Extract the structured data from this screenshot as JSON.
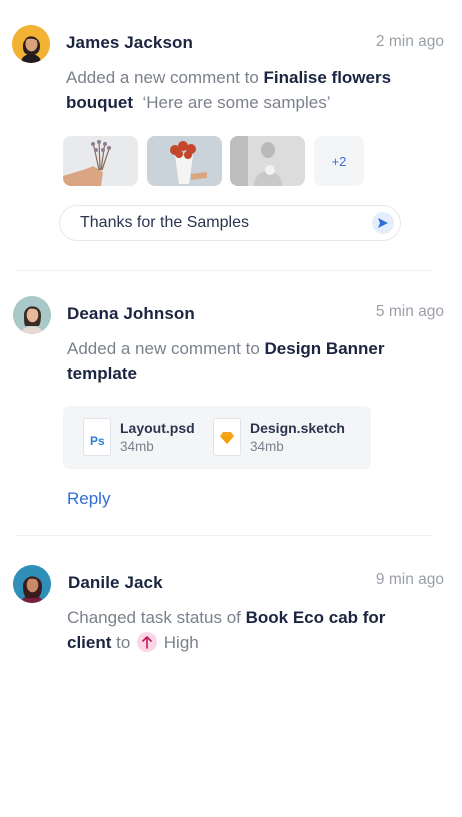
{
  "activities": [
    {
      "user": "James Jackson",
      "time": "2 min ago",
      "text_prefix": "Added a new comment to ",
      "target": "Finalise flowers bouquet",
      "quote": "‘Here are some samples’",
      "attachments_more": "+2",
      "reply_value": "Thanks for the Samples"
    },
    {
      "user": "Deana Johnson",
      "time": "5 min ago",
      "text_prefix": "Added a new comment to ",
      "target": "Design Banner template",
      "files": [
        {
          "name": "Layout.psd",
          "size": "34mb",
          "icon_label": "Ps"
        },
        {
          "name": "Design.sketch",
          "size": "34mb",
          "icon_label": ""
        }
      ],
      "reply_label": "Reply"
    },
    {
      "user": "Danile Jack",
      "time": "9 min ago",
      "text_prefix": "Changed task status of ",
      "target": "Book Eco cab for client",
      "to_word": " to ",
      "priority": "High"
    }
  ],
  "colors": {
    "accent": "#2f6ed8",
    "muted": "#7b818c",
    "dark": "#1b2540",
    "priority_bg": "#fbd6e4",
    "sketch": "#f7a51d",
    "photoshop": "#2f7fd8"
  }
}
